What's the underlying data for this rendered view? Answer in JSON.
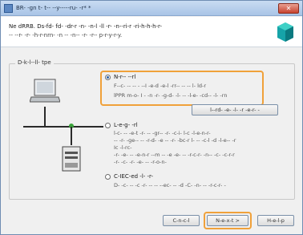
{
  "window": {
    "title": "BR- -gn t- t--   --y-----ru- -r* *",
    "close_glyph": "✕"
  },
  "header": {
    "line1": "Ne dRRB. Ds-fd- fd- -dr-r -n- -n-l -ll -r- -n--ri-r -ri-h-h-h-r-",
    "line2": "-- --r- -r- -h-r-nrn- -n -- -n-- -r- -r-- p-r-y-r-y."
  },
  "group": {
    "label": "D-k-l--ll- tpe"
  },
  "options": [
    {
      "title": "N-r-- --rl",
      "lines": [
        "F--c- -- -- - --I -e-d -e-l -rr-- -- -- l- ld-r",
        "lPPR m-o- I - -n -r- -g-d- -l- -- -l-e- -cd-- -l- -rn"
      ],
      "selected": true
    },
    {
      "title": "L-e-g- -rl",
      "lines": [
        "l-c- -- -e-t -r- -- -gr-- -r- -c-i- l-c -l-e-n-r-",
        "-- -r- -ge-- -- -r-d- -e -- -r- -bc-r l- -- -c-l -d -l-e-- -r",
        "Ic -l-rc-",
        "-r- -e- -- -e-n-r --m -- -e -e- -- -r-c-r- -n-- -c- -c-r-r",
        "-r- -c- -r- -e- -- -r-o-n-"
      ],
      "selected": false
    },
    {
      "title": "C-IEC-ed -l- -r-",
      "lines": [
        "D- -c- -- -c -r- -- -- --ec- -- -d -C- -n- -- -r-c-r- -"
      ],
      "selected": false
    }
  ],
  "buttons": {
    "option_button": "l--rd- -e- -l- -r -e-r- -",
    "cancel": "C-n-c-l",
    "next": "N-e-x-t  >",
    "help": "H-e-l-p"
  },
  "colors": {
    "accent": "#f0a13a",
    "titlebar": "#a9c4e6",
    "network": "#3aa33a"
  }
}
